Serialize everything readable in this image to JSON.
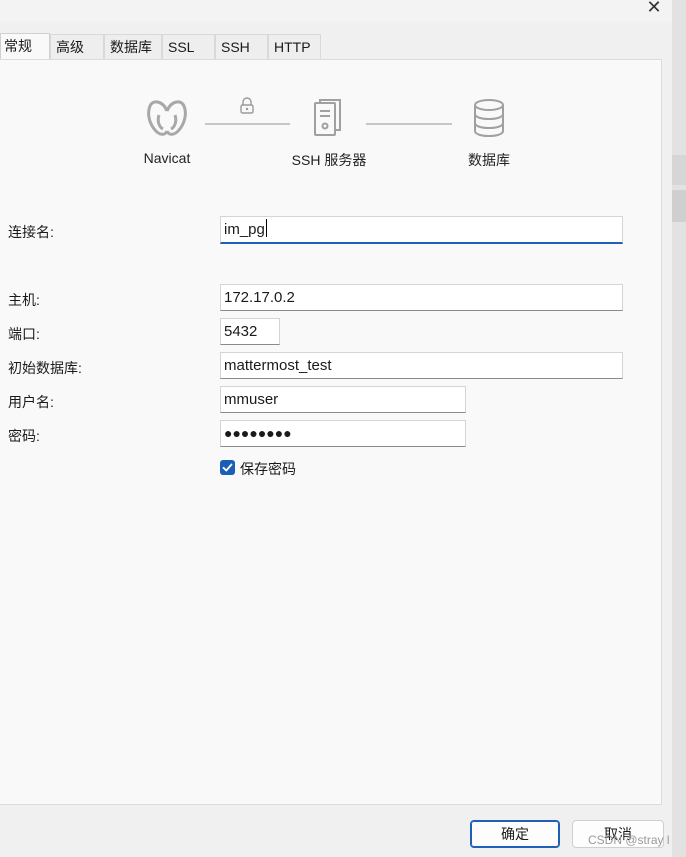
{
  "window": {
    "close_glyph": "✕"
  },
  "tabs": [
    {
      "label": "常规",
      "active": true
    },
    {
      "label": "高级"
    },
    {
      "label": "数据库"
    },
    {
      "label": "SSL"
    },
    {
      "label": "SSH"
    },
    {
      "label": "HTTP"
    }
  ],
  "diagram": {
    "navicat_label": "Navicat",
    "ssh_label": "SSH 服务器",
    "db_label": "数据库",
    "icons": [
      "navicat-logo-icon",
      "lock-icon",
      "server-icon",
      "database-icon"
    ]
  },
  "form": {
    "connection_name": {
      "label": "连接名:",
      "value": "im_pg"
    },
    "host": {
      "label": "主机:",
      "value": "172.17.0.2"
    },
    "port": {
      "label": "端口:",
      "value": "5432"
    },
    "initial_db": {
      "label": "初始数据库:",
      "value": "mattermost_test"
    },
    "username": {
      "label": "用户名:",
      "value": "mmuser"
    },
    "password": {
      "label": "密码:",
      "value": "●●●●●●●●"
    },
    "save_password": {
      "label": "保存密码",
      "checked": true
    }
  },
  "buttons": {
    "ok": "确定",
    "cancel": "取消"
  },
  "watermark": "CSDN @stray l",
  "colors": {
    "accent": "#1f5fb8",
    "checkbox": "#1a5fb4"
  }
}
